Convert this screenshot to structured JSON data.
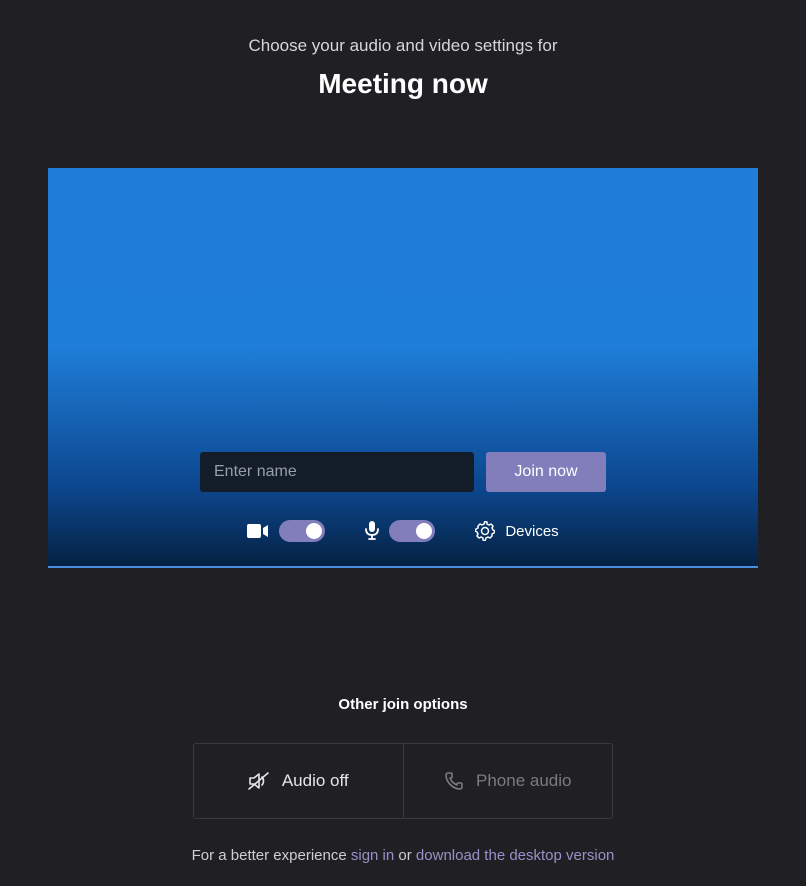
{
  "header": {
    "subtitle": "Choose your audio and video settings for",
    "title": "Meeting now"
  },
  "preview": {
    "name_placeholder": "Enter name",
    "join_label": "Join now",
    "devices_label": "Devices"
  },
  "other_options": {
    "title": "Other join options",
    "audio_off_label": "Audio off",
    "phone_audio_label": "Phone audio"
  },
  "footer": {
    "prefix": "For a better experience ",
    "sign_in": "sign in",
    "middle": " or ",
    "download": "download the desktop version"
  },
  "colors": {
    "accent": "#817ebb",
    "link": "#9692c9"
  }
}
